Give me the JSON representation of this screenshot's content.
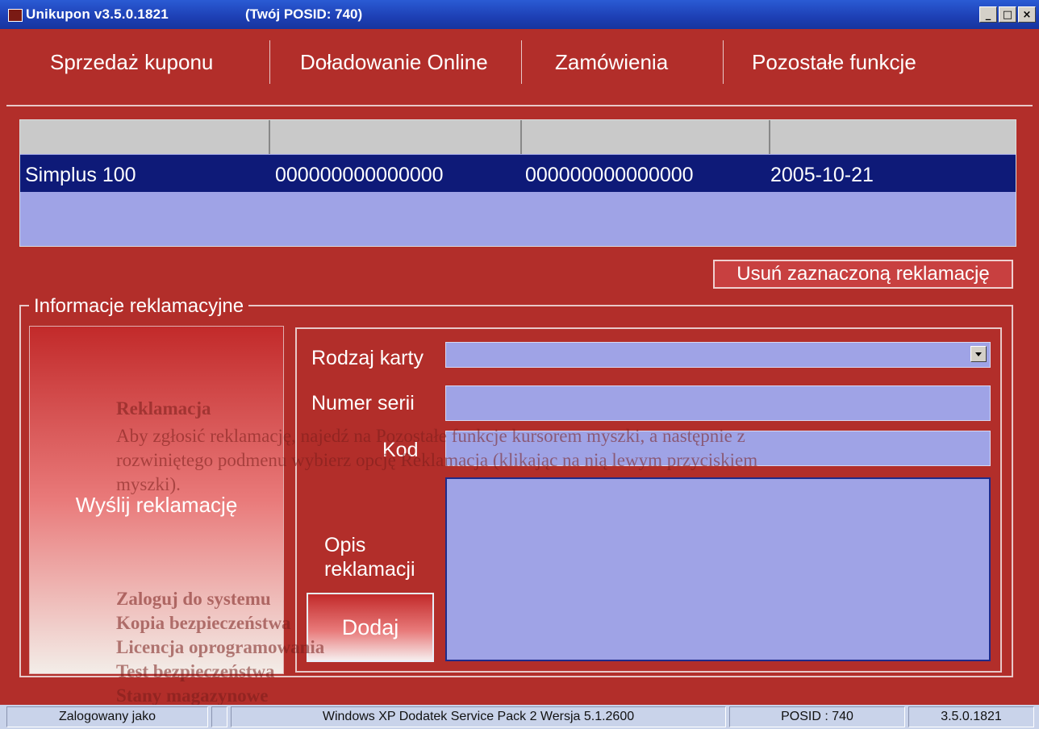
{
  "window": {
    "title": "Unikupon v3.5.0.1821",
    "posid_title": "(Twój POSID: 740)",
    "controls": [
      "_",
      "□",
      "×"
    ]
  },
  "menu": {
    "items": [
      "Sprzedaż kuponu",
      "Doładowanie Online",
      "Zamówienia",
      "Pozostałe funkcje"
    ]
  },
  "table": {
    "headers": [
      "",
      "",
      "",
      ""
    ],
    "rows": [
      [
        "Simplus 100",
        "000000000000000",
        "000000000000000",
        "2005-10-21"
      ]
    ]
  },
  "remove_button": "Usuń zaznaczoną reklamację",
  "complaint": {
    "legend": "Informacje reklamacyjne",
    "send_button": "Wyślij reklamację",
    "card_type_label": "Rodzaj karty",
    "card_type_value": "",
    "serial_label": "Numer serii",
    "serial_value": "",
    "code_label": "Kod",
    "code_value": "",
    "description_label_line1": "Opis",
    "description_label_line2": "reklamacji",
    "description_value": "",
    "add_button": "Dodaj"
  },
  "ghost_text": {
    "l1": "Reklamacja",
    "l2": "Aby zgłosić reklamację, najedź na Pozostałe funkcje kursorem myszki, a następnie z",
    "l3": "rozwiniętego podmenu wybierz opcję Reklamacja (klikając na nią lewym przyciskiem",
    "l4": "myszki).",
    "l5": "Zaloguj do systemu",
    "l6": "Kopia bezpieczeństwa",
    "l7": "Licencja oprogramowania",
    "l8": "Test bezpieczeństwa",
    "l9": "Stany magazynowe"
  },
  "status": {
    "logged_as": "Zalogowany jako",
    "user": "",
    "os": "Windows XP Dodatek Service Pack 2 Wersja 5.1.2600",
    "posid": "POSID : 740",
    "version": "3.5.0.1821"
  }
}
